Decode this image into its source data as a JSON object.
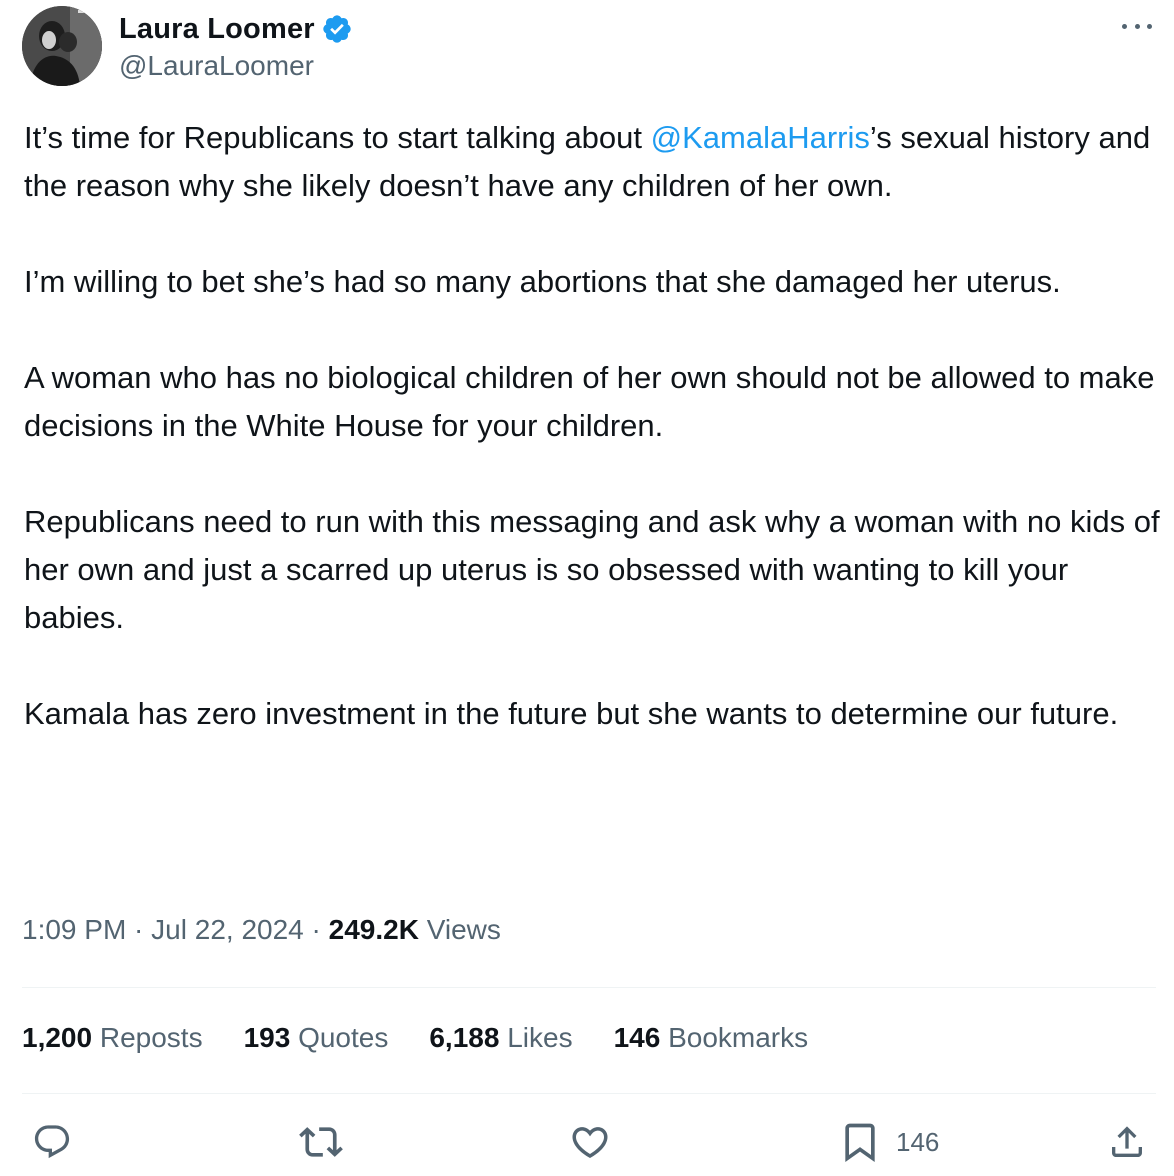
{
  "author": {
    "display_name": "Laura Loomer",
    "handle": "@LauraLoomer",
    "verified_icon": "verified-badge-icon",
    "avatar": "avatar-photo"
  },
  "tweet": {
    "p1_before": "It’s time for Republicans to start talking about ",
    "p1_mention": "@KamalaHarris",
    "p1_after": "’s sexual history and the reason why she likely doesn’t have any children of her own.",
    "p2": "I’m willing to bet she’s had so many abortions that she damaged her uterus.",
    "p3": "A woman who has no biological children of her own should not be allowed to make decisions in the White House for your children.",
    "p4": "Republicans need to run with this messaging and ask why a woman with no kids of her own and just a scarred up uterus is so obsessed with wanting to kill your babies.",
    "p5": "Kamala has zero investment in the future but she wants to determine our future."
  },
  "meta": {
    "time": "1:09 PM",
    "sep1": " · ",
    "date": "Jul 22, 2024",
    "sep2": " · ",
    "views_count": "249.2K",
    "views_label": " Views"
  },
  "stats": {
    "reposts_count": "1,200",
    "reposts_label": " Reposts",
    "quotes_count": "193",
    "quotes_label": " Quotes",
    "likes_count": "6,188",
    "likes_label": " Likes",
    "bookmarks_count": "146",
    "bookmarks_label": " Bookmarks"
  },
  "actions": {
    "reply_icon": "reply-icon",
    "repost_icon": "repost-icon",
    "like_icon": "heart-icon",
    "bookmark_icon": "bookmark-icon",
    "bookmark_count": "146",
    "share_icon": "share-icon"
  },
  "colors": {
    "accent": "#1d9bf0",
    "text": "#0f1419",
    "secondary": "#536471",
    "divider": "#eff3f4"
  }
}
